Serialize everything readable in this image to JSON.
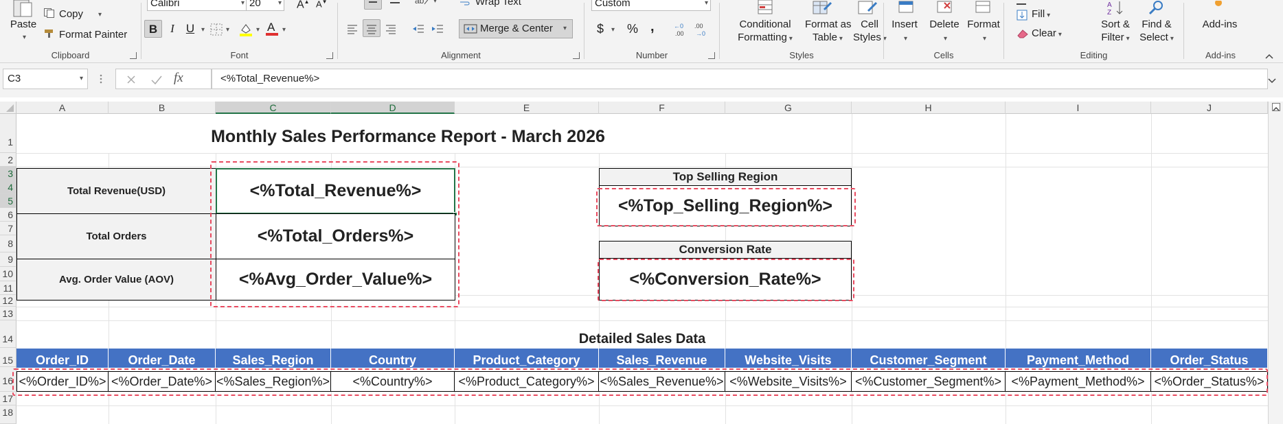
{
  "ribbon": {
    "clipboard": {
      "paste": "Paste",
      "copy": "Copy",
      "format_painter": "Format Painter",
      "label": "Clipboard"
    },
    "font": {
      "name": "Calibri",
      "size": "20",
      "bold": "B",
      "italic": "I",
      "underline": "U",
      "label": "Font"
    },
    "alignment": {
      "wrap_text": "Wrap Text",
      "merge_center": "Merge & Center",
      "label": "Alignment"
    },
    "number": {
      "format": "Custom",
      "currency": "$",
      "percent": "%",
      "comma": ",",
      "label": "Number"
    },
    "styles": {
      "conditional": "Conditional",
      "conditional2": "Formatting",
      "format_as": "Format as",
      "format_as2": "Table",
      "cell": "Cell",
      "cell2": "Styles",
      "label": "Styles"
    },
    "cells": {
      "insert": "Insert",
      "delete": "Delete",
      "format": "Format",
      "label": "Cells"
    },
    "editing": {
      "fill": "Fill",
      "clear": "Clear",
      "sort": "Sort &",
      "sort2": "Filter",
      "find": "Find &",
      "find2": "Select",
      "label": "Editing"
    },
    "addins": {
      "addins": "Add-ins",
      "label": "Add-ins"
    }
  },
  "formula_bar": {
    "name_box": "C3",
    "formula": "<%Total_Revenue%>",
    "fx": "fx"
  },
  "columns": [
    "A",
    "B",
    "C",
    "D",
    "E",
    "F",
    "G",
    "H",
    "I",
    "J"
  ],
  "rows": [
    "1",
    "2",
    "3",
    "4",
    "5",
    "6",
    "7",
    "8",
    "9",
    "10",
    "11",
    "12",
    "13",
    "14",
    "15",
    "16",
    "17",
    "18"
  ],
  "sheet": {
    "title": "Monthly Sales Performance Report - March 2026",
    "kpi_labels": [
      "Total Revenue(USD)",
      "Total Orders",
      "Avg. Order Value (AOV)"
    ],
    "kpi_values": [
      "<%Total_Revenue%>",
      "<%Total_Orders%>",
      "<%Avg_Order_Value%>"
    ],
    "top_region_title": "Top Selling Region",
    "top_region_value": "<%Top_Selling_Region%>",
    "conversion_title": "Conversion Rate",
    "conversion_value": "<%Conversion_Rate%>",
    "detail_title": "Detailed Sales Data",
    "table_headers": [
      "Order_ID",
      "Order_Date",
      "Sales_Region",
      "Country",
      "Product_Category",
      "Sales_Revenue",
      "Website_Visits",
      "Customer_Segment",
      "Payment_Method",
      "Order_Status"
    ],
    "table_row": [
      "<%Order_ID%>",
      "<%Order_Date%>",
      "<%Sales_Region%>",
      "<%Country%>",
      "<%Product_Category%>",
      "<%Sales_Revenue%>",
      "<%Website_Visits%>",
      "<%Customer_Segment%>",
      "<%Payment_Method%>",
      "<%Order_Status%>"
    ]
  },
  "colors": {
    "header_fill": "#4472c4",
    "label_fill": "#f2f2f2",
    "dash": "#e84a5f",
    "excel_green": "#217346"
  }
}
